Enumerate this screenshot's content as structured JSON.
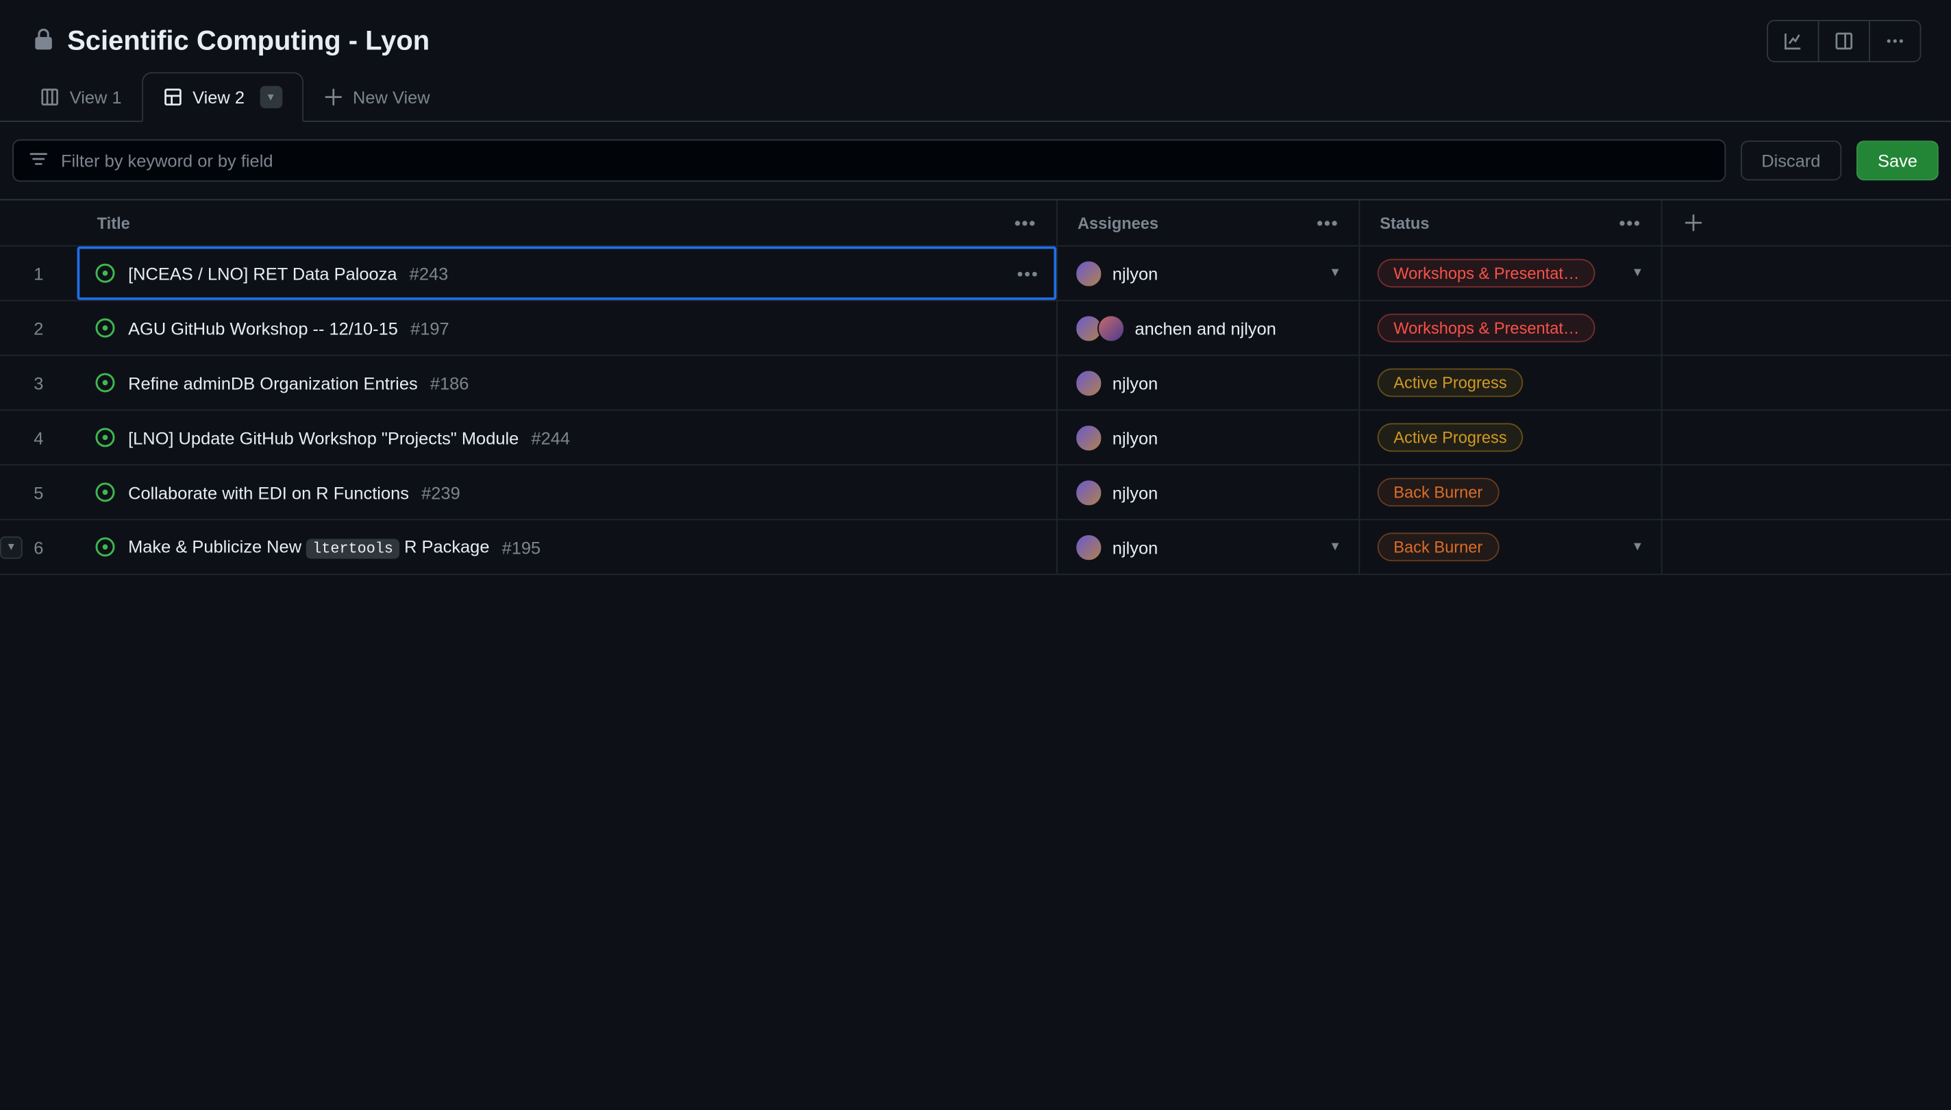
{
  "header": {
    "title": "Scientific Computing - Lyon",
    "lock_icon": "lock-icon"
  },
  "tabs": [
    {
      "label": "View 1",
      "icon": "board-icon",
      "active": false
    },
    {
      "label": "View 2",
      "icon": "table-icon",
      "active": true
    }
  ],
  "new_view_label": "New View",
  "filter": {
    "placeholder": "Filter by keyword or by field"
  },
  "buttons": {
    "discard": "Discard",
    "save": "Save"
  },
  "columns": {
    "title": "Title",
    "assignees": "Assignees",
    "status": "Status"
  },
  "statuses": {
    "workshops": "Workshops & Presentat…",
    "active": "Active Progress",
    "back": "Back Burner"
  },
  "rows": [
    {
      "num": "1",
      "title": "[NCEAS / LNO] RET Data Palooza",
      "issue": "#243",
      "assignees_text": "njlyon",
      "avatars": 1,
      "status": "workshops",
      "selected": true,
      "show_row_actions": true
    },
    {
      "num": "2",
      "title": "AGU GitHub Workshop -- 12/10-15",
      "issue": "#197",
      "assignees_text": "anchen and njlyon",
      "avatars": 2,
      "status": "workshops"
    },
    {
      "num": "3",
      "title": "Refine adminDB Organization Entries",
      "issue": "#186",
      "assignees_text": "njlyon",
      "avatars": 1,
      "status": "active"
    },
    {
      "num": "4",
      "title": "[LNO] Update GitHub Workshop \"Projects\" Module",
      "issue": "#244",
      "assignees_text": "njlyon",
      "avatars": 1,
      "status": "active"
    },
    {
      "num": "5",
      "title": "Collaborate with EDI on R Functions",
      "issue": "#239",
      "assignees_text": "njlyon",
      "avatars": 1,
      "status": "back"
    },
    {
      "num": "6",
      "title_pre": "Make & Publicize New ",
      "title_code": "ltertools",
      "title_post": " R Package",
      "issue": "#195",
      "assignees_text": "njlyon",
      "avatars": 1,
      "status": "back",
      "expander": true,
      "always_show_dropdowns": true
    }
  ]
}
